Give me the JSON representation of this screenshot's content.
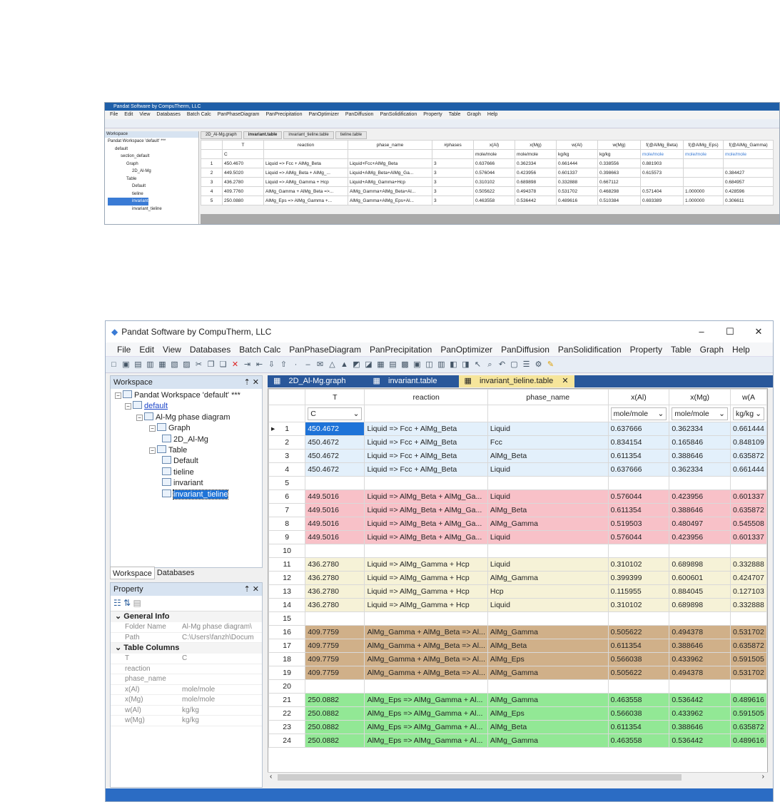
{
  "small": {
    "title": "Pandat Software by CompuTherm, LLC",
    "menu": [
      "File",
      "Edit",
      "View",
      "Databases",
      "Batch Calc",
      "PanPhaseDiagram",
      "PanPrecipitation",
      "PanOptimizer",
      "PanDiffusion",
      "PanSolidification",
      "Property",
      "Table",
      "Graph",
      "Help"
    ],
    "workspace_label": "Workspace",
    "tree": [
      "Pandat Workspace 'default' ***",
      "default",
      "section_default",
      "Graph",
      "2D_Al-Mg",
      "Table",
      "Default",
      "tieline",
      "invariant",
      "invariant_tieline"
    ],
    "tabs": [
      "2D_Al-Mg.graph",
      "invariant.table",
      "invariant_tieline.table",
      "tieline.table"
    ],
    "headers": [
      "",
      "T",
      "reaction",
      "phase_name",
      "#phases",
      "x(Al)",
      "x(Mg)",
      "w(Al)",
      "w(Mg)",
      "f(@AlMg_Beta)",
      "f(@AlMg_Eps)",
      "f(@AlMg_Gamma)"
    ],
    "units": [
      "",
      "C",
      "",
      "",
      "",
      "mole/mole",
      "mole/mole",
      "kg/kg",
      "kg/kg",
      "mole/mole",
      "mole/mole",
      "mole/mole"
    ],
    "rows": [
      [
        "1",
        "450.4670",
        "Liquid => Fcc + AlMg_Beta",
        "Liquid+Fcc+AlMg_Beta",
        "3",
        "0.637666",
        "0.362334",
        "0.661444",
        "0.338556",
        "0.881903",
        "",
        ""
      ],
      [
        "2",
        "449.5020",
        "Liquid => AlMg_Beta + AlMg_...",
        "Liquid+AlMg_Beta+AlMg_Ga...",
        "3",
        "0.576044",
        "0.423956",
        "0.601337",
        "0.398663",
        "0.615573",
        "",
        "0.384427"
      ],
      [
        "3",
        "436.2780",
        "Liquid => AlMg_Gamma + Hcp",
        "Liquid+AlMg_Gamma+Hcp",
        "3",
        "0.310102",
        "0.689898",
        "0.332888",
        "0.667112",
        "",
        "",
        "0.684957"
      ],
      [
        "4",
        "409.7760",
        "AlMg_Gamma + AlMg_Beta =>...",
        "AlMg_Gamma+AlMg_Beta+Al...",
        "3",
        "0.505622",
        "0.494378",
        "0.531702",
        "0.468298",
        "0.571404",
        "1.000000",
        "0.428596"
      ],
      [
        "5",
        "250.0880",
        "AlMg_Eps => AlMg_Gamma +...",
        "AlMg_Gamma+AlMg_Eps+Al...",
        "3",
        "0.463558",
        "0.536442",
        "0.489616",
        "0.510384",
        "0.693389",
        "1.000000",
        "0.306611"
      ]
    ]
  },
  "main": {
    "title": "Pandat Software by CompuTherm, LLC",
    "win": [
      "–",
      "☐",
      "✕"
    ],
    "menu": [
      "File",
      "Edit",
      "View",
      "Databases",
      "Batch Calc",
      "PanPhaseDiagram",
      "PanPrecipitation",
      "PanOptimizer",
      "PanDiffusion",
      "PanSolidification",
      "Property",
      "Table",
      "Graph",
      "Help"
    ],
    "workspace_label": "Workspace",
    "pin": "⇡ ✕",
    "tree": [
      "Pandat Workspace 'default' ***",
      "default",
      "Al-Mg phase diagram",
      "Graph",
      "2D_Al-Mg",
      "Table",
      "Default",
      "tieline",
      "invariant",
      "invariant_tieline"
    ],
    "panel_tabs": [
      "Workspace",
      "Databases"
    ],
    "property_label": "Property",
    "general_info": "General Info",
    "props_general": [
      [
        "Folder Name",
        "Al-Mg phase diagram\\"
      ],
      [
        "Path",
        "C:\\Users\\fanzh\\Docum"
      ]
    ],
    "table_columns": "Table Columns",
    "props_cols": [
      [
        "T",
        "C"
      ],
      [
        "reaction",
        ""
      ],
      [
        "phase_name",
        ""
      ],
      [
        "x(Al)",
        "mole/mole"
      ],
      [
        "x(Mg)",
        "mole/mole"
      ],
      [
        "w(Al)",
        "kg/kg"
      ],
      [
        "w(Mg)",
        "kg/kg"
      ]
    ],
    "tabs": [
      "2D_Al-Mg.graph",
      "invariant.table",
      "invariant_tieline.table"
    ],
    "tab_close": "✕",
    "headers": [
      "T",
      "reaction",
      "phase_name",
      "x(Al)",
      "x(Mg)",
      "w(A"
    ],
    "units": [
      "C",
      "",
      "",
      "mole/mole",
      "mole/mole",
      "kg/kg"
    ],
    "row_marker": "▸",
    "colors": {
      "blue": "#e3f0fb",
      "pink": "#f8c1c8",
      "cream": "#f6f2d7",
      "tan": "#d0b089",
      "green": "#92e895",
      "sel": "#1e73d8"
    },
    "rows": [
      {
        "n": "1",
        "g": "blue",
        "c": [
          "450.4672",
          "Liquid => Fcc + AlMg_Beta",
          "Liquid",
          "0.637666",
          "0.362334",
          "0.661444"
        ]
      },
      {
        "n": "2",
        "g": "blue",
        "c": [
          "450.4672",
          "Liquid => Fcc + AlMg_Beta",
          "Fcc",
          "0.834154",
          "0.165846",
          "0.848109"
        ]
      },
      {
        "n": "3",
        "g": "blue",
        "c": [
          "450.4672",
          "Liquid => Fcc + AlMg_Beta",
          "AlMg_Beta",
          "0.611354",
          "0.388646",
          "0.635872"
        ]
      },
      {
        "n": "4",
        "g": "blue",
        "c": [
          "450.4672",
          "Liquid => Fcc + AlMg_Beta",
          "Liquid",
          "0.637666",
          "0.362334",
          "0.661444"
        ]
      },
      {
        "n": "5",
        "g": "",
        "c": [
          "",
          "",
          "",
          "",
          "",
          ""
        ]
      },
      {
        "n": "6",
        "g": "pink",
        "c": [
          "449.5016",
          "Liquid => AlMg_Beta + AlMg_Ga...",
          "Liquid",
          "0.576044",
          "0.423956",
          "0.601337"
        ]
      },
      {
        "n": "7",
        "g": "pink",
        "c": [
          "449.5016",
          "Liquid => AlMg_Beta + AlMg_Ga...",
          "AlMg_Beta",
          "0.611354",
          "0.388646",
          "0.635872"
        ]
      },
      {
        "n": "8",
        "g": "pink",
        "c": [
          "449.5016",
          "Liquid => AlMg_Beta + AlMg_Ga...",
          "AlMg_Gamma",
          "0.519503",
          "0.480497",
          "0.545508"
        ]
      },
      {
        "n": "9",
        "g": "pink",
        "c": [
          "449.5016",
          "Liquid => AlMg_Beta + AlMg_Ga...",
          "Liquid",
          "0.576044",
          "0.423956",
          "0.601337"
        ]
      },
      {
        "n": "10",
        "g": "",
        "c": [
          "",
          "",
          "",
          "",
          "",
          ""
        ]
      },
      {
        "n": "11",
        "g": "cream",
        "c": [
          "436.2780",
          "Liquid => AlMg_Gamma + Hcp",
          "Liquid",
          "0.310102",
          "0.689898",
          "0.332888"
        ]
      },
      {
        "n": "12",
        "g": "cream",
        "c": [
          "436.2780",
          "Liquid => AlMg_Gamma + Hcp",
          "AlMg_Gamma",
          "0.399399",
          "0.600601",
          "0.424707"
        ]
      },
      {
        "n": "13",
        "g": "cream",
        "c": [
          "436.2780",
          "Liquid => AlMg_Gamma + Hcp",
          "Hcp",
          "0.115955",
          "0.884045",
          "0.127103"
        ]
      },
      {
        "n": "14",
        "g": "cream",
        "c": [
          "436.2780",
          "Liquid => AlMg_Gamma + Hcp",
          "Liquid",
          "0.310102",
          "0.689898",
          "0.332888"
        ]
      },
      {
        "n": "15",
        "g": "",
        "c": [
          "",
          "",
          "",
          "",
          "",
          ""
        ]
      },
      {
        "n": "16",
        "g": "tan",
        "c": [
          "409.7759",
          "AlMg_Gamma + AlMg_Beta => Al...",
          "AlMg_Gamma",
          "0.505622",
          "0.494378",
          "0.531702"
        ]
      },
      {
        "n": "17",
        "g": "tan",
        "c": [
          "409.7759",
          "AlMg_Gamma + AlMg_Beta => Al...",
          "AlMg_Beta",
          "0.611354",
          "0.388646",
          "0.635872"
        ]
      },
      {
        "n": "18",
        "g": "tan",
        "c": [
          "409.7759",
          "AlMg_Gamma + AlMg_Beta => Al...",
          "AlMg_Eps",
          "0.566038",
          "0.433962",
          "0.591505"
        ]
      },
      {
        "n": "19",
        "g": "tan",
        "c": [
          "409.7759",
          "AlMg_Gamma + AlMg_Beta => Al...",
          "AlMg_Gamma",
          "0.505622",
          "0.494378",
          "0.531702"
        ]
      },
      {
        "n": "20",
        "g": "",
        "c": [
          "",
          "",
          "",
          "",
          "",
          ""
        ]
      },
      {
        "n": "21",
        "g": "green",
        "c": [
          "250.0882",
          "AlMg_Eps => AlMg_Gamma + Al...",
          "AlMg_Gamma",
          "0.463558",
          "0.536442",
          "0.489616"
        ]
      },
      {
        "n": "22",
        "g": "green",
        "c": [
          "250.0882",
          "AlMg_Eps => AlMg_Gamma + Al...",
          "AlMg_Eps",
          "0.566038",
          "0.433962",
          "0.591505"
        ]
      },
      {
        "n": "23",
        "g": "green",
        "c": [
          "250.0882",
          "AlMg_Eps => AlMg_Gamma + Al...",
          "AlMg_Beta",
          "0.611354",
          "0.388646",
          "0.635872"
        ]
      },
      {
        "n": "24",
        "g": "green",
        "c": [
          "250.0882",
          "AlMg_Eps => AlMg_Gamma + Al...",
          "AlMg_Gamma",
          "0.463558",
          "0.536442",
          "0.489616"
        ]
      }
    ]
  }
}
